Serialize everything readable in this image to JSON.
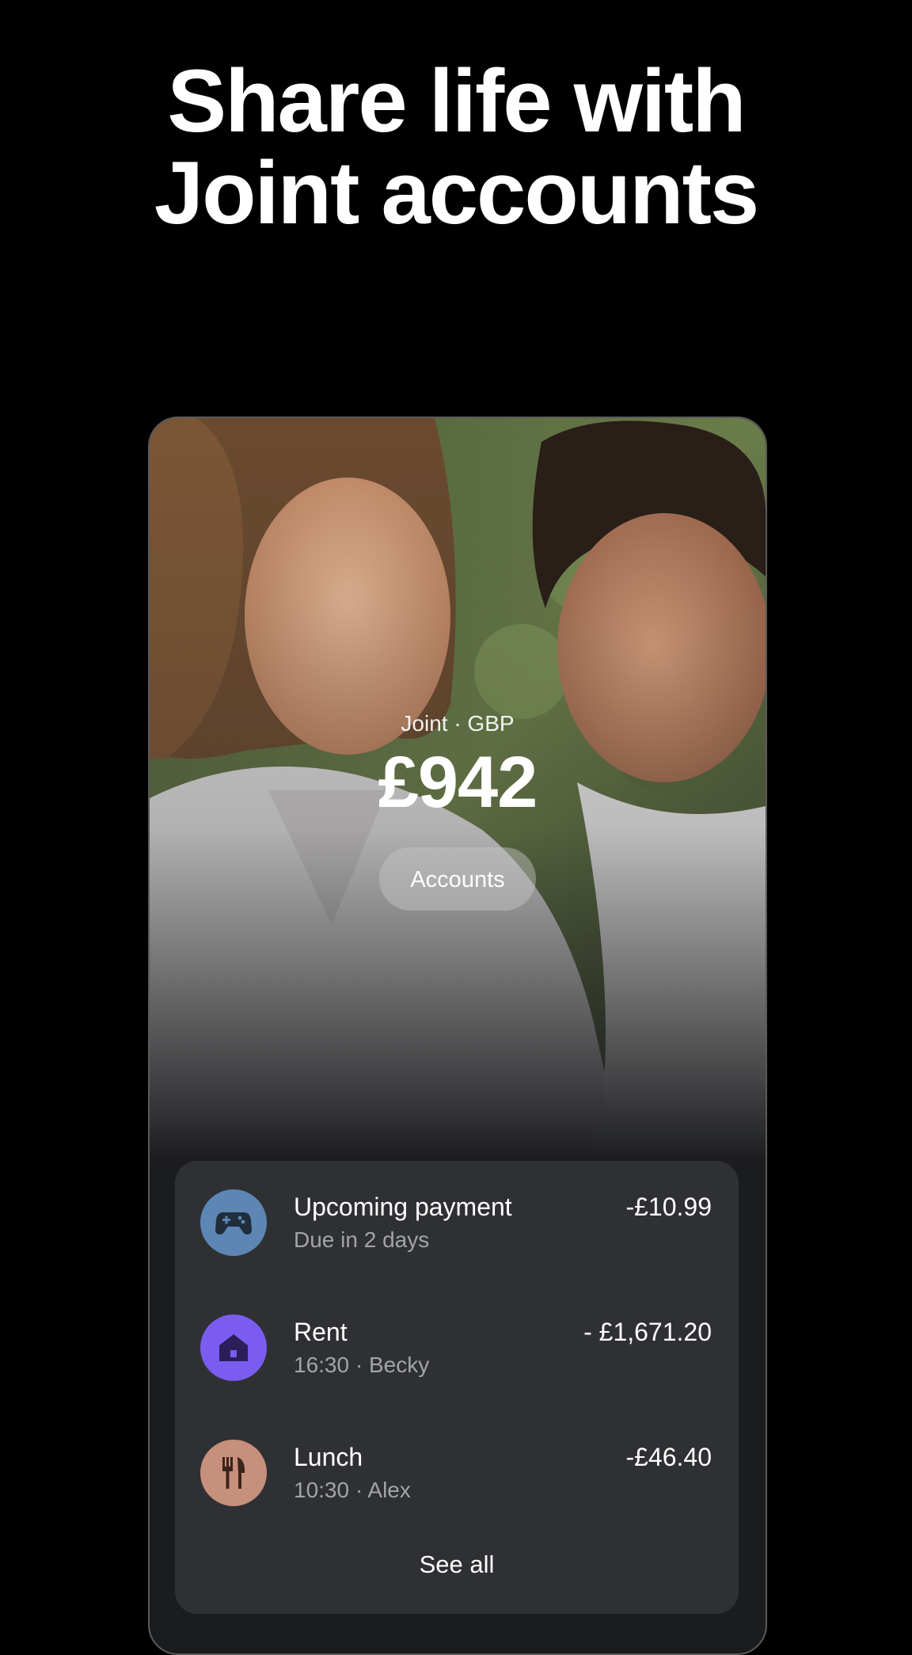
{
  "headline": {
    "line1": "Share life with",
    "line2": "Joint accounts"
  },
  "hero": {
    "account_label": "Joint · GBP",
    "balance": "£942",
    "accounts_button": "Accounts"
  },
  "transactions": [
    {
      "title": "Upcoming payment",
      "subtitle": "Due in 2 days",
      "amount": "-£10.99",
      "icon": "gamepad-icon",
      "icon_color": "#5d86b5"
    },
    {
      "title": "Rent",
      "subtitle": "16:30 · Becky",
      "amount": "- £1,671.20",
      "icon": "house-icon",
      "icon_color": "#7a5cf0"
    },
    {
      "title": "Lunch",
      "subtitle": "10:30  ·  Alex",
      "amount": "-£46.40",
      "icon": "cutlery-icon",
      "icon_color": "#c7907c"
    }
  ],
  "see_all": "See all",
  "colors": {
    "background": "#000000",
    "card": "#2f3033",
    "muted_text": "#a3a4a8"
  }
}
